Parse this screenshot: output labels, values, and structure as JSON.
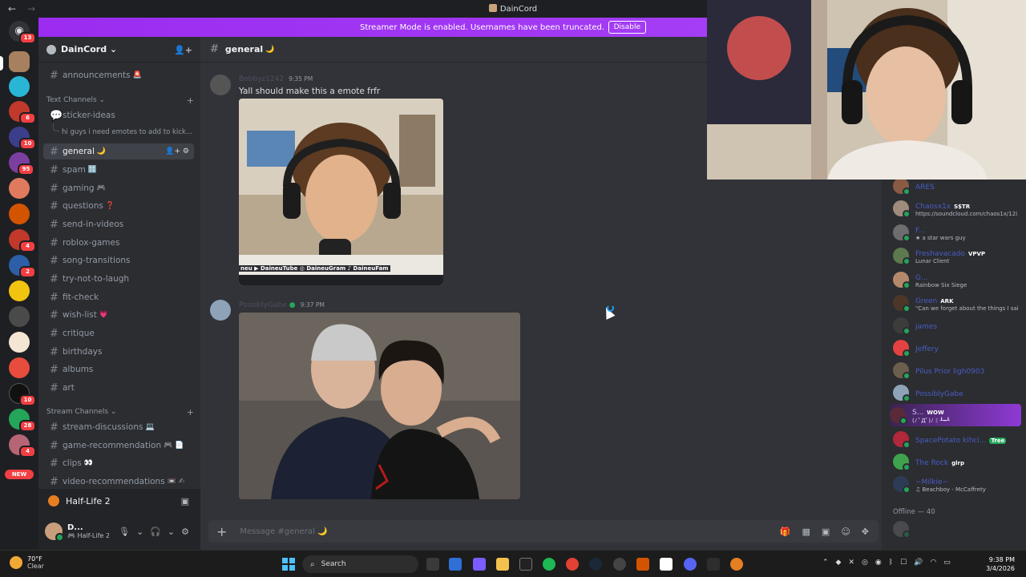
{
  "window": {
    "title": "DainCord",
    "back": "←",
    "forward": "→"
  },
  "banner": {
    "message": "Streamer Mode is enabled. Usernames have been truncated.",
    "button": "Disable"
  },
  "server": {
    "name": "DainCord ⌄"
  },
  "rail_badges": [
    "13",
    "6",
    "10",
    "95",
    "4",
    "2",
    "10",
    "28",
    "4"
  ],
  "rail_new": "NEW",
  "channels": {
    "top": {
      "name": "announcements",
      "emoji": "🚨"
    },
    "text_category": "Text Channels ⌄",
    "forum": {
      "name": "sticker-ideas",
      "thread": "hi guys i need emotes to add to kick gi..."
    },
    "items": [
      {
        "name": "general",
        "emoji": "🌙"
      },
      {
        "name": "spam",
        "emoji": "🔠"
      },
      {
        "name": "gaming",
        "emoji": "🎮"
      },
      {
        "name": "questions",
        "emoji": "❓"
      },
      {
        "name": "send-in-videos",
        "emoji": ""
      },
      {
        "name": "roblox-games",
        "emoji": ""
      },
      {
        "name": "song-transitions",
        "emoji": ""
      },
      {
        "name": "try-not-to-laugh",
        "emoji": ""
      },
      {
        "name": "fit-check",
        "emoji": ""
      },
      {
        "name": "wish-list",
        "emoji": "💗"
      },
      {
        "name": "critique",
        "emoji": ""
      },
      {
        "name": "birthdays",
        "emoji": ""
      },
      {
        "name": "albums",
        "emoji": ""
      },
      {
        "name": "art",
        "emoji": ""
      }
    ],
    "stream_category": "Stream Channels ⌄",
    "stream_items": [
      {
        "name": "stream-discussions",
        "emoji": "💻"
      },
      {
        "name": "game-recommendation",
        "emoji": "🎮 📄"
      },
      {
        "name": "clips",
        "emoji": "👀"
      },
      {
        "name": "video-recommendations",
        "emoji": "📼 ✍"
      }
    ]
  },
  "activity": {
    "game": "Half-Life 2"
  },
  "user": {
    "name": "D...",
    "status": "Half-Life 2"
  },
  "chat": {
    "channel": "general",
    "channel_emoji": "🌙",
    "messages": [
      {
        "author": "Bobbyz1242",
        "time": "9:35 PM",
        "text": "Yall should make this a emote frfr",
        "image_caption": "neu ▶ DaineuTube ◎ DaineuGram ♪ DaineuFam"
      },
      {
        "author": "PossiblyGabe",
        "time": "9:37 PM",
        "text": ""
      }
    ],
    "placeholder": "Message #general 🌙"
  },
  "members": [
    {
      "name": "ARES",
      "tag": "",
      "sub": ""
    },
    {
      "name": "Chaosx1x",
      "tag": "S$TR",
      "sub": "https://soundcloud.com/chaos1x/12i"
    },
    {
      "name": "F...",
      "tag": "",
      "sub": "★ a star wars guy"
    },
    {
      "name": "Freshavacado",
      "tag": "VPVP",
      "sub": "Lunar Client"
    },
    {
      "name": "G...",
      "tag": "",
      "sub": "Rainbow Six Siege"
    },
    {
      "name": "Green",
      "tag": "ARK",
      "sub": "\"Can we forget about the things I sai"
    },
    {
      "name": "james",
      "tag": "",
      "sub": ""
    },
    {
      "name": "Jeffery",
      "tag": "",
      "sub": ""
    },
    {
      "name": "Pilus Prior ligh0903",
      "tag": "",
      "sub": ""
    },
    {
      "name": "PossiblyGabe",
      "tag": "",
      "sub": ""
    },
    {
      "name": "S...",
      "tag": "WOW",
      "sub": "(ﾉ ﾟДﾟ)ﾉ ﾐ ┸━┸"
    },
    {
      "name": "SpacePotato kihci...",
      "tag": "Tree",
      "sub": ""
    },
    {
      "name": "The Rock",
      "tag": "glrp",
      "sub": ""
    },
    {
      "name": "~Milkie~",
      "tag": "",
      "sub": "♫ Beachboy - McCaffrety"
    }
  ],
  "offline_label": "Offline — 40",
  "taskbar": {
    "temp": "70°F",
    "weather": "Clear",
    "search": "Search",
    "time": "9:38 PM",
    "date": "3/4/2026"
  }
}
